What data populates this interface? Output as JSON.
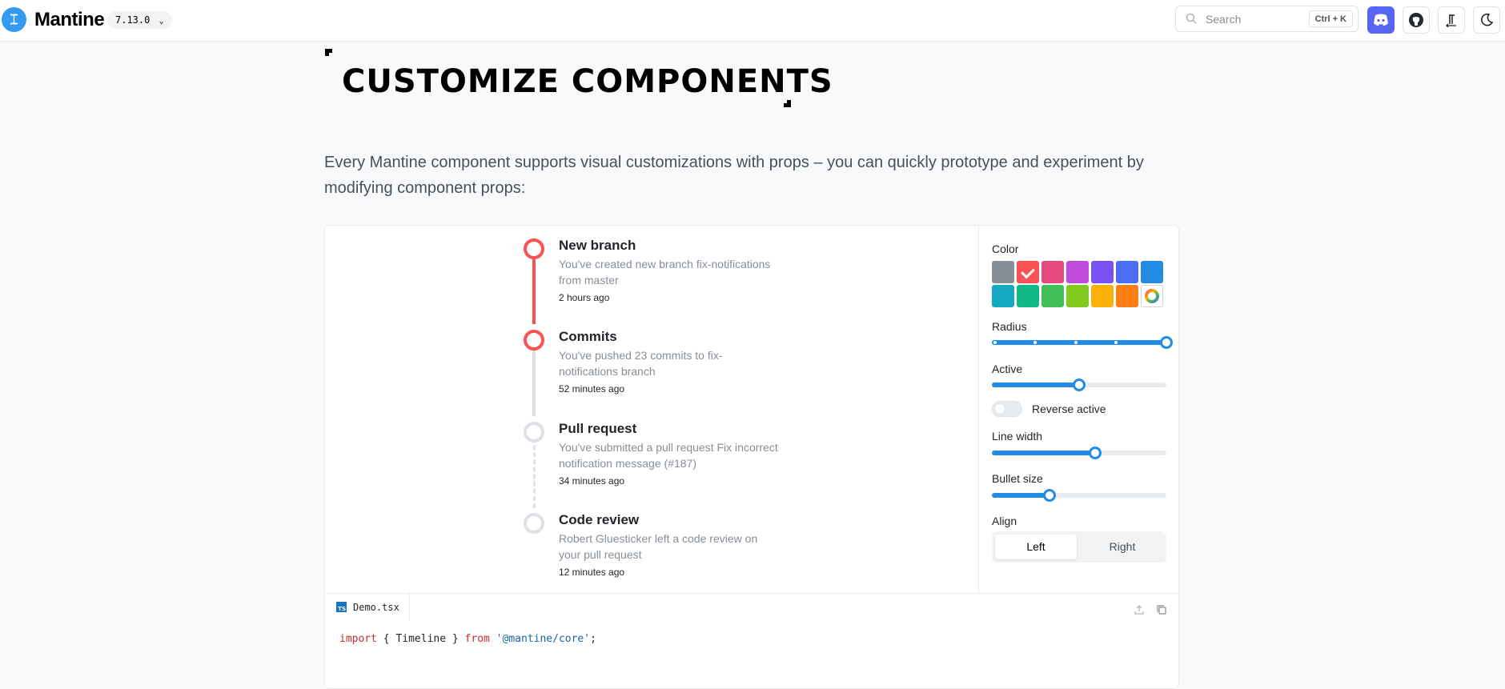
{
  "header": {
    "logo_mark": "⌶",
    "logo_text": "Mantine",
    "version": "7.13.0",
    "search_placeholder": "Search",
    "search_shortcut": "Ctrl + K",
    "buttons": [
      "discord-icon",
      "github-icon",
      "text-direction-icon",
      "moon-icon"
    ]
  },
  "hero": {
    "title": "CUSTOMIZE COMPONENTS",
    "description": "Every Mantine component supports visual customizations with props – you can quickly prototype and experiment by modifying component props:"
  },
  "timeline": {
    "active_color": "#fa5252",
    "items": [
      {
        "title": "New branch",
        "text": "You've created new branch fix-notifications from master",
        "time": "2 hours ago"
      },
      {
        "title": "Commits",
        "text": "You've pushed 23 commits to fix-notifications branch",
        "time": "52 minutes ago"
      },
      {
        "title": "Pull request",
        "text": "You've submitted a pull request Fix incorrect notification message (#187)",
        "time": "34 minutes ago"
      },
      {
        "title": "Code review",
        "text": "Robert Gluesticker left a code review on your pull request",
        "time": "12 minutes ago"
      }
    ]
  },
  "controls": {
    "color_label": "Color",
    "colors": [
      "#868e96",
      "#fa5252",
      "#e64980",
      "#be4bdb",
      "#7950f2",
      "#4c6ef5",
      "#228be6",
      "#15aabf",
      "#12b886",
      "#40c057",
      "#82c91e",
      "#fab005",
      "#fd7e14"
    ],
    "selected_color": "#fa5252",
    "radius_label": "Radius",
    "radius_value": 1.0,
    "active_label": "Active",
    "active_value": 0.5,
    "reverse_active_label": "Reverse active",
    "reverse_active_on": false,
    "line_width_label": "Line width",
    "line_width_value": 0.59,
    "bullet_size_label": "Bullet size",
    "bullet_size_value": 0.33,
    "align_label": "Align",
    "align_options": [
      "Left",
      "Right"
    ],
    "align_selected": "Left"
  },
  "code": {
    "filename": "Demo.tsx",
    "file_icon_text": "TS",
    "line_keyword_import": "import",
    "line_middle": " { Timeline } ",
    "line_keyword_from": "from",
    "line_string": " '@mantine/core'",
    "line_end": ";"
  }
}
